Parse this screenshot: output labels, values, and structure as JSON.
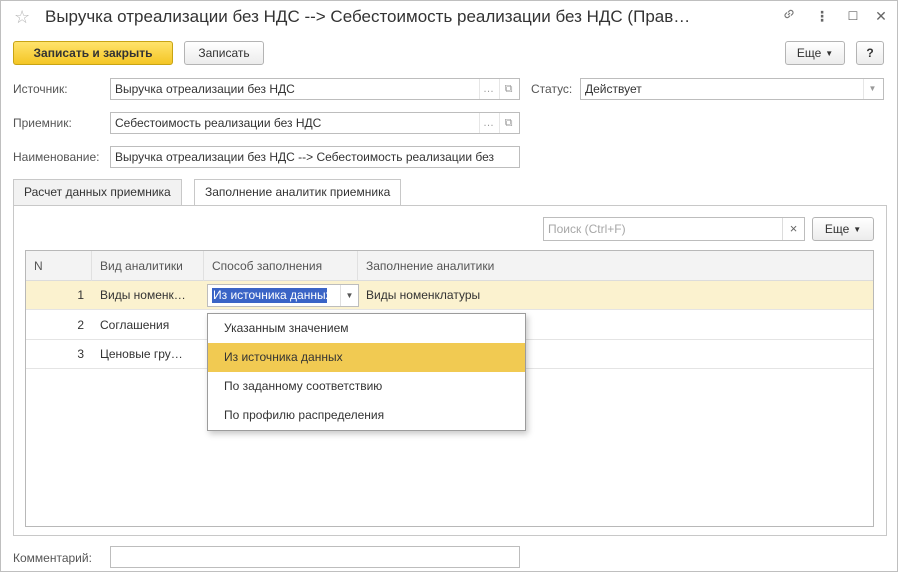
{
  "window": {
    "title": "Выручка отреализации без НДС --> Себестоимость реализации без НДС (Прав…",
    "star_icon": "☆",
    "link_icon": "link-icon",
    "more_icon": "⋮",
    "maximize_icon": "☐",
    "close_icon": "✕"
  },
  "toolbar": {
    "save_close_label": "Записать и закрыть",
    "save_label": "Записать",
    "more_label": "Еще",
    "help_label": "?"
  },
  "form": {
    "source_label": "Источник:",
    "source_value": "Выручка отреализации без НДС",
    "receiver_label": "Приемник:",
    "receiver_value": "Себестоимость реализации без НДС",
    "name_label": "Наименование:",
    "name_value": "Выручка отреализации без НДС --> Себестоимость реализации без",
    "status_label": "Статус:",
    "status_value": "Действует",
    "comment_label": "Комментарий:",
    "comment_value": ""
  },
  "tabs": [
    {
      "label": "Расчет данных приемника",
      "active": false
    },
    {
      "label": "Заполнение аналитик приемника",
      "active": true
    }
  ],
  "search": {
    "placeholder": "Поиск (Ctrl+F)",
    "clear_icon": "×",
    "more_label": "Еще"
  },
  "table": {
    "columns": [
      "N",
      "Вид аналитики",
      "Способ заполнения",
      "Заполнение аналитики"
    ],
    "rows": [
      {
        "n": "1",
        "kind": "Виды номенк…",
        "method": "Из источника данных",
        "fill": "Виды номенклатуры",
        "selected": true
      },
      {
        "n": "2",
        "kind": "Соглашения",
        "method": "",
        "fill": "",
        "selected": false
      },
      {
        "n": "3",
        "kind": "Ценовые гру…",
        "method": "",
        "fill": "",
        "selected": false
      }
    ]
  },
  "dropdown": {
    "options": [
      "Указанным значением",
      "Из источника данных",
      "По заданному соответствию",
      "По профилю распределения"
    ],
    "highlighted_index": 1
  },
  "colors": {
    "primary_button": "#f4c625",
    "selected_row": "#fbf2cf",
    "highlighted_option": "#f1ca52",
    "selected_text_bg": "#3a64c6"
  }
}
